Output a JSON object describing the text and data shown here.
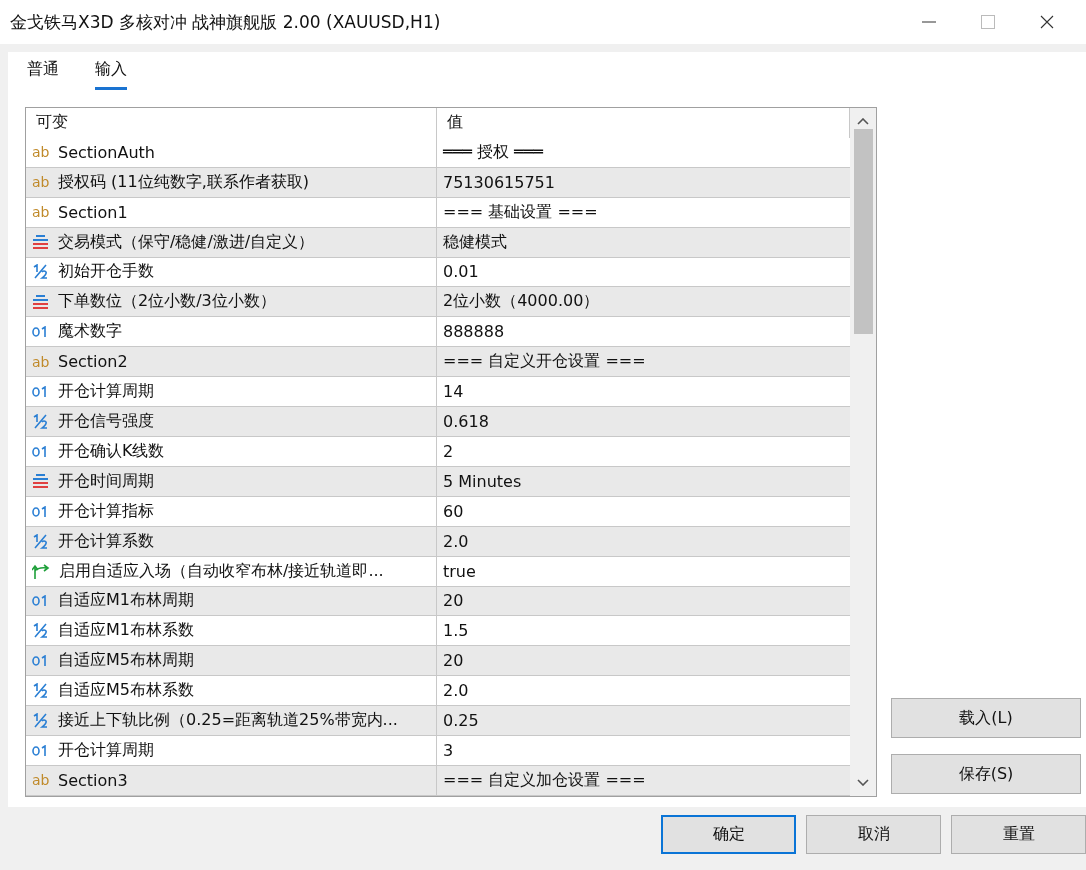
{
  "window": {
    "title": "金戈铁马X3D 多核对冲 战神旗舰版 2.00 (XAUUSD,H1)"
  },
  "tabs": [
    {
      "label": "普通",
      "selected": false
    },
    {
      "label": "输入",
      "selected": true
    }
  ],
  "table": {
    "columns": [
      "可变",
      "值"
    ],
    "rows": [
      {
        "kind": "string",
        "icon": "ab",
        "name": "SectionAuth",
        "value": "═══ 授权 ═══"
      },
      {
        "kind": "string",
        "icon": "ab",
        "name": "授权码 (11位纯数字,联系作者获取)",
        "value": "75130615751"
      },
      {
        "kind": "string",
        "icon": "ab",
        "name": "Section1",
        "value": "=== 基础设置 ==="
      },
      {
        "kind": "enum",
        "name": "交易模式（保守/稳健/激进/自定义）",
        "value": "稳健模式"
      },
      {
        "kind": "double",
        "name": "初始开仓手数",
        "value": "0.01"
      },
      {
        "kind": "enum",
        "name": "下单数位（2位小数/3位小数）",
        "value": "2位小数（4000.00）"
      },
      {
        "kind": "int",
        "name": "魔术数字",
        "value": "888888"
      },
      {
        "kind": "string",
        "icon": "ab",
        "name": "Section2",
        "value": "=== 自定义开仓设置 ==="
      },
      {
        "kind": "int",
        "name": "开仓计算周期",
        "value": "14"
      },
      {
        "kind": "double",
        "name": "开仓信号强度",
        "value": "0.618"
      },
      {
        "kind": "int",
        "name": "开仓确认K线数",
        "value": "2"
      },
      {
        "kind": "enum",
        "name": "开仓时间周期",
        "value": "5 Minutes"
      },
      {
        "kind": "int",
        "name": "开仓计算指标",
        "value": "60"
      },
      {
        "kind": "double",
        "name": "开仓计算系数",
        "value": "2.0"
      },
      {
        "kind": "bool",
        "name": "启用自适应入场（自动收窄布林/接近轨道即...",
        "value": "true"
      },
      {
        "kind": "int",
        "name": "自适应M1布林周期",
        "value": "20"
      },
      {
        "kind": "double",
        "name": "自适应M1布林系数",
        "value": "1.5"
      },
      {
        "kind": "int",
        "name": "自适应M5布林周期",
        "value": "20"
      },
      {
        "kind": "double",
        "name": "自适应M5布林系数",
        "value": "2.0"
      },
      {
        "kind": "double",
        "name": "接近上下轨比例（0.25=距离轨道25%带宽内...",
        "value": "0.25"
      },
      {
        "kind": "int",
        "name": "开仓计算周期",
        "value": "3"
      },
      {
        "kind": "string",
        "icon": "ab",
        "name": "Section3",
        "value": "=== 自定义加仓设置 ==="
      }
    ]
  },
  "side_buttons": [
    "载入(L)",
    "保存(S)"
  ],
  "footer_buttons": [
    {
      "label": "确定",
      "default": true
    },
    {
      "label": "取消",
      "default": false
    },
    {
      "label": "重置",
      "default": false
    }
  ]
}
